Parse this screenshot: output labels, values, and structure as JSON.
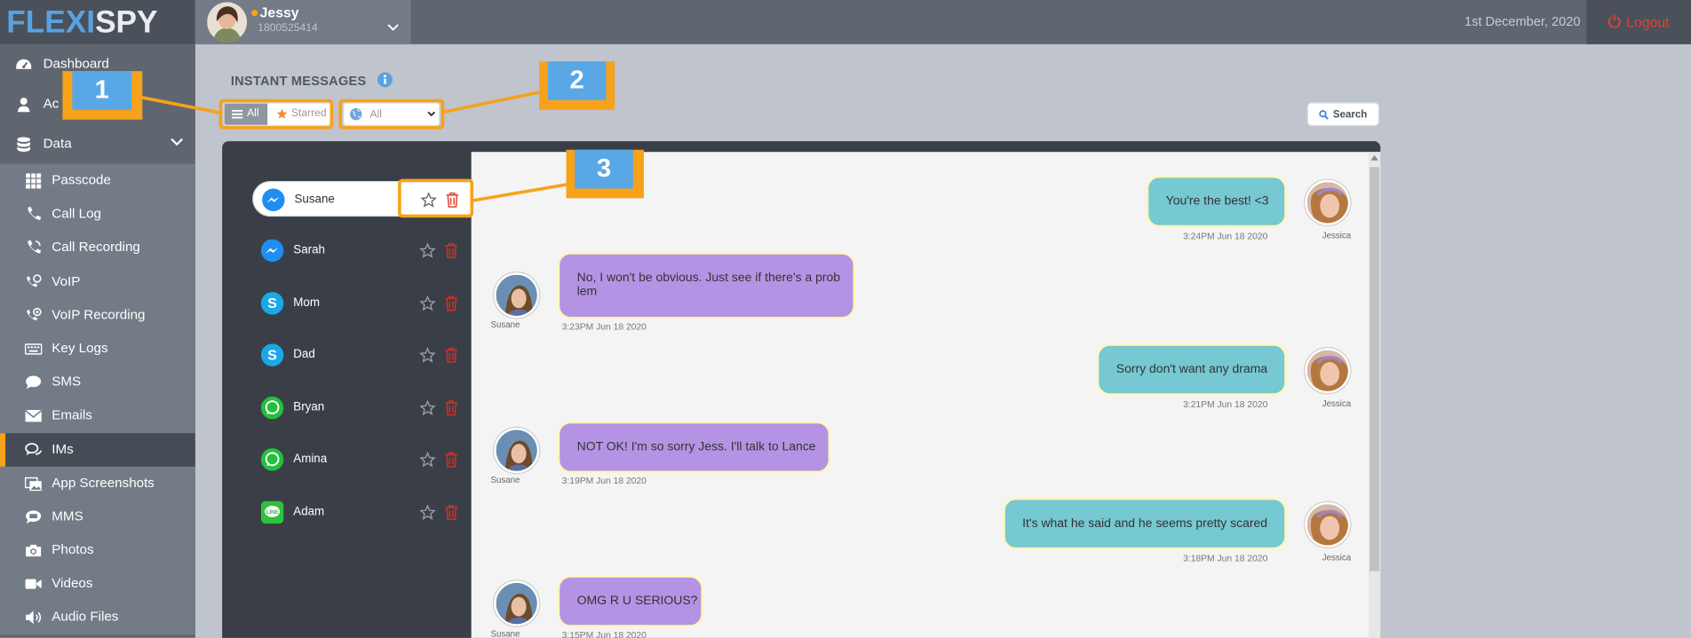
{
  "logo": {
    "part1": "FLEXI",
    "part2": "SPY"
  },
  "user": {
    "name": "Jessy",
    "number": "1800525414"
  },
  "topbar": {
    "date": "1st December, 2020",
    "logout_label": "Logout"
  },
  "nav": {
    "top": [
      {
        "label": "Dashboard",
        "icon": "dashboard-icon"
      },
      {
        "label": "Ac",
        "icon": "account-icon"
      },
      {
        "label": "Data",
        "icon": "database-icon"
      }
    ],
    "sub": [
      {
        "label": "Passcode",
        "icon": "grid-icon"
      },
      {
        "label": "Call Log",
        "icon": "phone-icon"
      },
      {
        "label": "Call Recording",
        "icon": "phone-recording-icon"
      },
      {
        "label": "VoIP",
        "icon": "voip-icon"
      },
      {
        "label": "VoIP Recording",
        "icon": "voip-recording-icon"
      },
      {
        "label": "Key Logs",
        "icon": "keyboard-icon"
      },
      {
        "label": "SMS",
        "icon": "chat-bubble-icon"
      },
      {
        "label": "Emails",
        "icon": "envelope-icon"
      },
      {
        "label": "IMs",
        "icon": "comments-icon",
        "active": true
      },
      {
        "label": "App Screenshots",
        "icon": "screenshot-icon"
      },
      {
        "label": "MMS",
        "icon": "mms-icon"
      },
      {
        "label": "Photos",
        "icon": "camera-icon"
      },
      {
        "label": "Videos",
        "icon": "video-icon"
      },
      {
        "label": "Audio Files",
        "icon": "speaker-icon"
      }
    ]
  },
  "page": {
    "title": "INSTANT MESSAGES",
    "filter_all": "All",
    "filter_starred": "Starred",
    "app_select_value": "All",
    "search_label": "Search"
  },
  "contacts": [
    {
      "name": "Susane",
      "app": "messenger"
    },
    {
      "name": "Sarah",
      "app": "messenger"
    },
    {
      "name": "Mom",
      "app": "skype"
    },
    {
      "name": "Dad",
      "app": "skype"
    },
    {
      "name": "Bryan",
      "app": "whatsapp"
    },
    {
      "name": "Amina",
      "app": "whatsapp"
    },
    {
      "name": "Adam",
      "app": "line"
    }
  ],
  "messages": [
    {
      "dir": "out",
      "text": "You're the best! <3",
      "time": "3:24PM Jun 18 2020",
      "sender": "Jessica"
    },
    {
      "dir": "in",
      "text": "No, I won't be obvious. Just see if there's a prob lem",
      "time": "3:23PM Jun 18 2020",
      "sender": "Susane"
    },
    {
      "dir": "out",
      "text": "Sorry don't want any drama",
      "time": "3:21PM Jun 18 2020",
      "sender": "Jessica"
    },
    {
      "dir": "in",
      "text": "NOT OK! I'm so sorry Jess. I'll talk to Lance",
      "time": "3:19PM Jun 18 2020",
      "sender": "Susane"
    },
    {
      "dir": "out",
      "text": "It's what he said and he seems pretty scared",
      "time": "3:18PM Jun 18 2020",
      "sender": "Jessica"
    },
    {
      "dir": "in",
      "text": "OMG R U SERIOUS?",
      "time": "3:15PM Jun 18 2020",
      "sender": "Susane"
    }
  ],
  "callouts": [
    "1",
    "2",
    "3"
  ],
  "colors": {
    "accent": "#f7a21b",
    "badge": "#5aa7e6",
    "sidebar": "#5f6670",
    "outgoing": "#76c8d2",
    "incoming": "#b593e4",
    "logout": "#e2412f"
  }
}
